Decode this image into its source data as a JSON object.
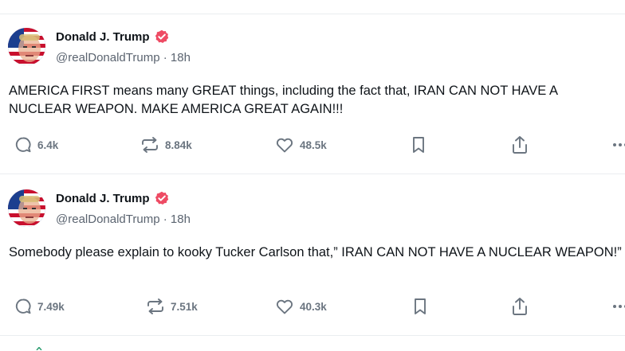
{
  "posts": [
    {
      "author": "Donald J. Trump",
      "handle": "@realDonaldTrump",
      "separator": "·",
      "time": "18h",
      "text": "AMERICA FIRST means many GREAT things, including the fact that, IRAN CAN NOT HAVE A NUCLEAR WEAPON. MAKE AMERICA GREAT AGAIN!!!",
      "replies": "6.4k",
      "reposts": "8.84k",
      "likes": "48.5k"
    },
    {
      "author": "Donald J. Trump",
      "handle": "@realDonaldTrump",
      "separator": "·",
      "time": "18h",
      "text": "Somebody please explain to kooky Tucker Carlson that,” IRAN CAN NOT HAVE A NUCLEAR WEAPON!”",
      "replies": "7.49k",
      "reposts": "7.51k",
      "likes": "40.3k"
    }
  ],
  "icons": {
    "reply": "reply-icon",
    "repost": "repost-icon",
    "like": "like-icon",
    "bookmark": "bookmark-icon",
    "share": "share-icon",
    "more": "more-icon",
    "verified": "verified-badge-icon"
  },
  "colors": {
    "verified": "#ee4b64",
    "action_gray": "#6b7580",
    "handle_gray": "#5b6470"
  }
}
